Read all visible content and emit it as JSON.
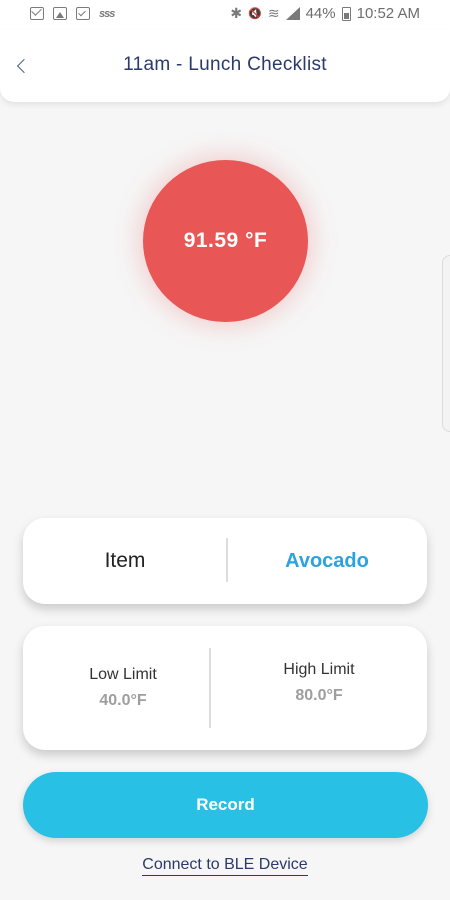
{
  "status_bar": {
    "left_icons": [
      "mail-icon",
      "photo-icon",
      "checklist-icon",
      "sss-icon"
    ],
    "sss_text": "sss",
    "bluetooth_glyph": "✱",
    "mute_glyph": "🔇",
    "wifi_glyph": "≋",
    "battery_percent": "44%",
    "time": "10:52 AM"
  },
  "header": {
    "title": "11am - Lunch Checklist",
    "back_icon": "chevron-left-icon"
  },
  "temperature": {
    "value": "91.59 °F",
    "color": "#e85656"
  },
  "item": {
    "label": "Item",
    "value": "Avocado",
    "value_color": "#2aa3e0"
  },
  "limits": {
    "low_label": "Low Limit",
    "low_value": "40.0°F",
    "high_label": "High Limit",
    "high_value": "80.0°F"
  },
  "record_button": {
    "label": "Record",
    "color": "#29c0e6"
  },
  "ble_link": {
    "label": "Connect to BLE Device"
  }
}
